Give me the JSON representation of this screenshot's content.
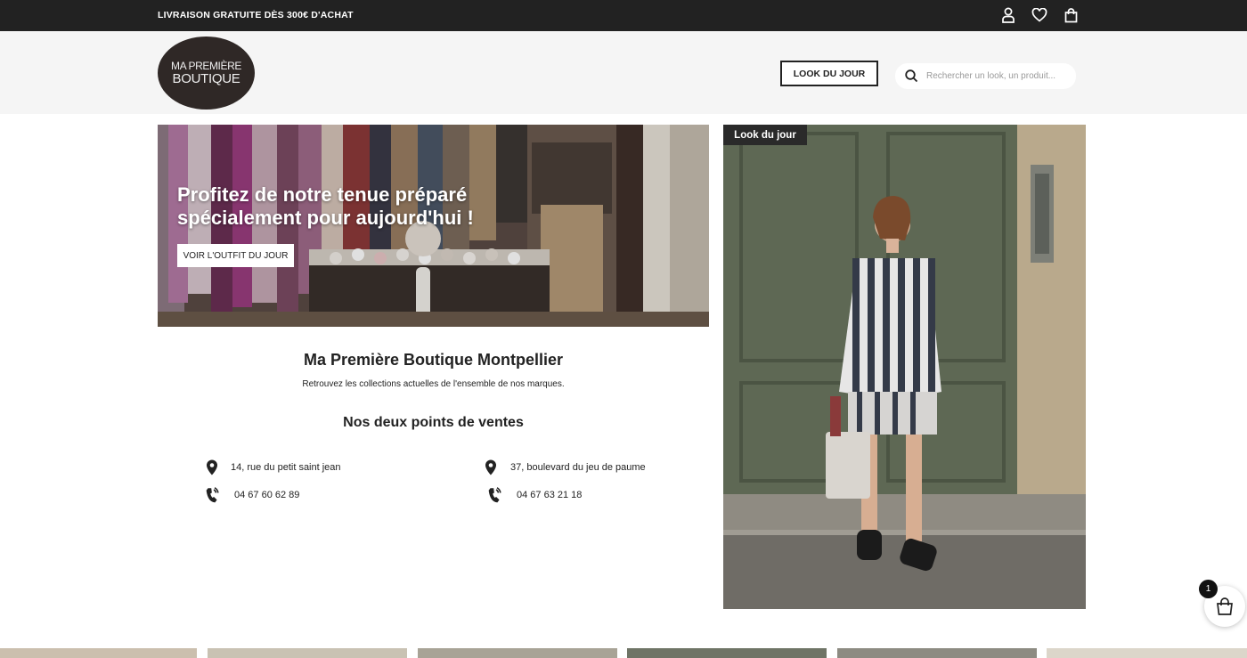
{
  "topbar": {
    "announcement": "LIVRAISON GRATUITE DÈS 300€ D'ACHAT",
    "icons": [
      "user-icon",
      "heart-icon",
      "bag-icon"
    ]
  },
  "header": {
    "logo_line1": "MA PREMIÈRE",
    "logo_line2": "BOUTIQUE",
    "look_button": "LOOK DU JOUR",
    "search_placeholder": "Rechercher un look, un produit..."
  },
  "hero": {
    "title": "Profitez de notre tenue préparé spécialement pour aujourd'hui !",
    "button": "VOIR L'OUTFIT DU JOUR"
  },
  "store": {
    "title": "Ma Première Boutique Montpellier",
    "subtitle": "Retrouvez les collections actuelles de l'ensemble de nos marques.",
    "sales_title": "Nos deux points de ventes",
    "locations": [
      {
        "address": "14, rue du petit saint jean",
        "phone": "04 67 60 62 89"
      },
      {
        "address": "37, boulevard du jeu de paume",
        "phone": "04 67 63 21 18"
      }
    ]
  },
  "look": {
    "badge": "Look du jour"
  },
  "cart": {
    "count": "1"
  },
  "colors": {
    "topbar": "#222222",
    "header_bg": "#f5f5f5",
    "logo_bg": "#2f2826",
    "text": "#222222"
  }
}
